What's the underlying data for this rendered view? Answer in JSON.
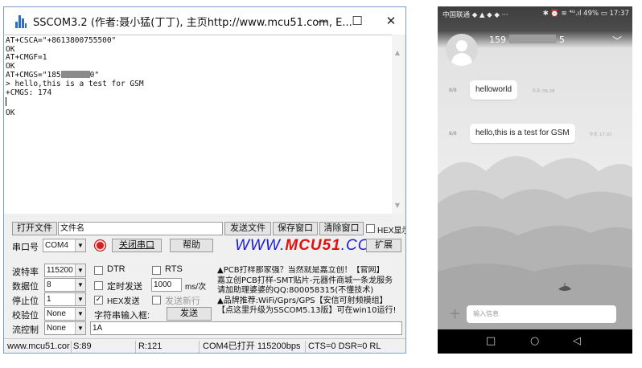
{
  "sscom": {
    "title": "SSCOM3.2 (作者:聂小猛(丁丁), 主页http://www.mcu51.com,  E...",
    "controls": {
      "minimize": "—",
      "maximize": "☐",
      "close": "✕"
    },
    "console_lines": [
      "AT+CSCA=\"+8613800755500\"",
      "OK",
      "AT+CMGF=1",
      "OK"
    ],
    "cmgs_prefix": "AT+CMGS=\"185",
    "cmgs_suffix": "0\"",
    "console_lines_2": [
      "> hello,this is a test for GSM",
      "+CMGS: 174"
    ],
    "console_ok": "OK",
    "open_file_btn": "打开文件",
    "filename": "文件名",
    "send_file_btn": "发送文件",
    "save_window_btn": "保存窗口",
    "clear_window_btn": "清除窗口",
    "hex_display": "HEX显示",
    "port_label": "串口号",
    "port_value": "COM4",
    "close_port_btn": "关闭串口",
    "help_btn": "帮助",
    "brand_prefix": "WWW.",
    "brand_mid": "MCU51",
    "brand_suffix": ".COM",
    "expand_btn": "扩展",
    "baud_label": "波特率",
    "baud_value": "115200",
    "databits_label": "数据位",
    "databits_value": "8",
    "stopbits_label": "停止位",
    "stopbits_value": "1",
    "parity_label": "校验位",
    "parity_value": "None",
    "flow_label": "流控制",
    "flow_value": "None",
    "dtr": "DTR",
    "rts": "RTS",
    "timed_send": "定时发送",
    "interval_value": "1000",
    "interval_unit": "ms/次",
    "hex_send": "HEX发送",
    "send_newline": "发送新行",
    "string_input_label": "字符串输入框:",
    "send_btn": "发送",
    "input_value": "1A",
    "ad_lines": [
      "▲PCB打样那家强？当然就是嘉立创！【官网】",
      "嘉立创PCB打样-SMT贴片-元器件商城一条龙服务",
      "请加助理婆婆的QQ:800058315(不懂技术)",
      "▲品牌推荐:WiFi/Gprs/GPS【安信可射频模组】",
      "【点这里升级为SSCOM5.13版】可在win10运行!"
    ],
    "status": {
      "url": "www.mcu51.cor",
      "sent": "S:89",
      "received": "R:121",
      "port_state": "COM4已打开  115200bps",
      "lines": "CTS=0 DSR=0 RL"
    }
  },
  "phone": {
    "status_left": "中国联通 ◆ ▲ ◆ ◆  ···",
    "status_right": "✱ ⏰ ≋ ⁴ᴳ.ıl 49% ▭ 17:37",
    "contact_prefix": "159",
    "contact_suffix": "5",
    "chevron": "﹀",
    "messages": [
      {
        "label": "8/8",
        "text": "helloworld",
        "time": "今天 09:28"
      },
      {
        "label": "8/8",
        "text": "hello,this is a test for GSM",
        "time": "今天 17:37"
      }
    ],
    "add": "+",
    "input_placeholder": "输入信息",
    "nav_back": "◁",
    "nav_home": "○",
    "nav_recent": "□"
  }
}
